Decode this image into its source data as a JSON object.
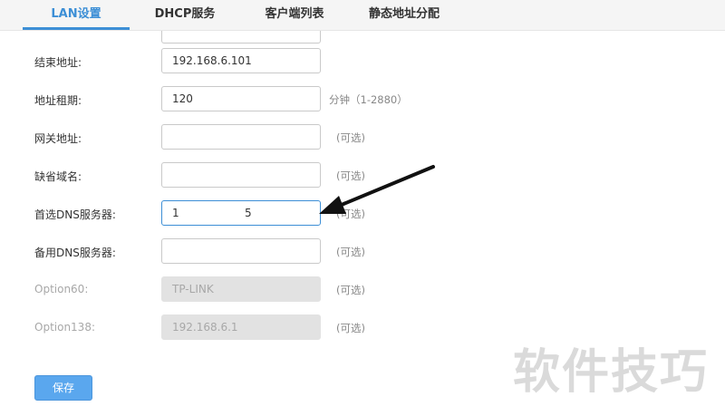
{
  "tabs": [
    {
      "label": "LAN设置",
      "active": true
    },
    {
      "label": "DHCP服务",
      "active": false
    },
    {
      "label": "客户端列表",
      "active": false
    },
    {
      "label": "静态地址分配",
      "active": false
    }
  ],
  "form": {
    "end_address": {
      "label": "结束地址:",
      "value": "192.168.6.101"
    },
    "lease": {
      "label": "地址租期:",
      "value": "120",
      "hint": "分钟（1-2880）"
    },
    "gateway": {
      "label": "网关地址:",
      "value": "",
      "hint": "(可选)"
    },
    "domain": {
      "label": "缺省域名:",
      "value": "",
      "hint": "(可选)"
    },
    "dns_primary": {
      "label": "首选DNS服务器:",
      "value_left": "1",
      "value_right": "5",
      "hint": "(可选)"
    },
    "dns_secondary": {
      "label": "备用DNS服务器:",
      "value": "",
      "hint": "(可选)"
    },
    "option60": {
      "label": "Option60:",
      "value": "TP-LINK",
      "hint": "(可选)"
    },
    "option138": {
      "label": "Option138:",
      "value": "192.168.6.1",
      "hint": "(可选)"
    }
  },
  "save_label": "保存",
  "watermark": "软件技巧",
  "colors": {
    "accent": "#3d8fd6",
    "button": "#5aa7ee",
    "disabled_bg": "#e2e2e2"
  }
}
